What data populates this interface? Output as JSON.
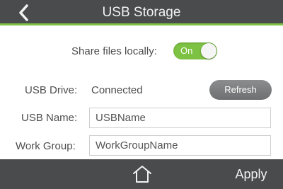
{
  "header": {
    "title": "USB Storage",
    "back_icon": "chevron-left-icon"
  },
  "share": {
    "label": "Share files locally:",
    "toggle_state": "On",
    "enabled": true
  },
  "drive": {
    "label": "USB Drive:",
    "status": "Connected",
    "refresh_label": "Refresh"
  },
  "usb_name": {
    "label": "USB Name:",
    "value": "USBName"
  },
  "work_group": {
    "label": "Work Group:",
    "value": "WorkGroupName"
  },
  "footer": {
    "home_icon": "home-icon",
    "apply_label": "Apply"
  },
  "colors": {
    "header_bg": "#4a4b4c",
    "accent": "#7dc242",
    "button_gray": "#7a7b7c"
  }
}
